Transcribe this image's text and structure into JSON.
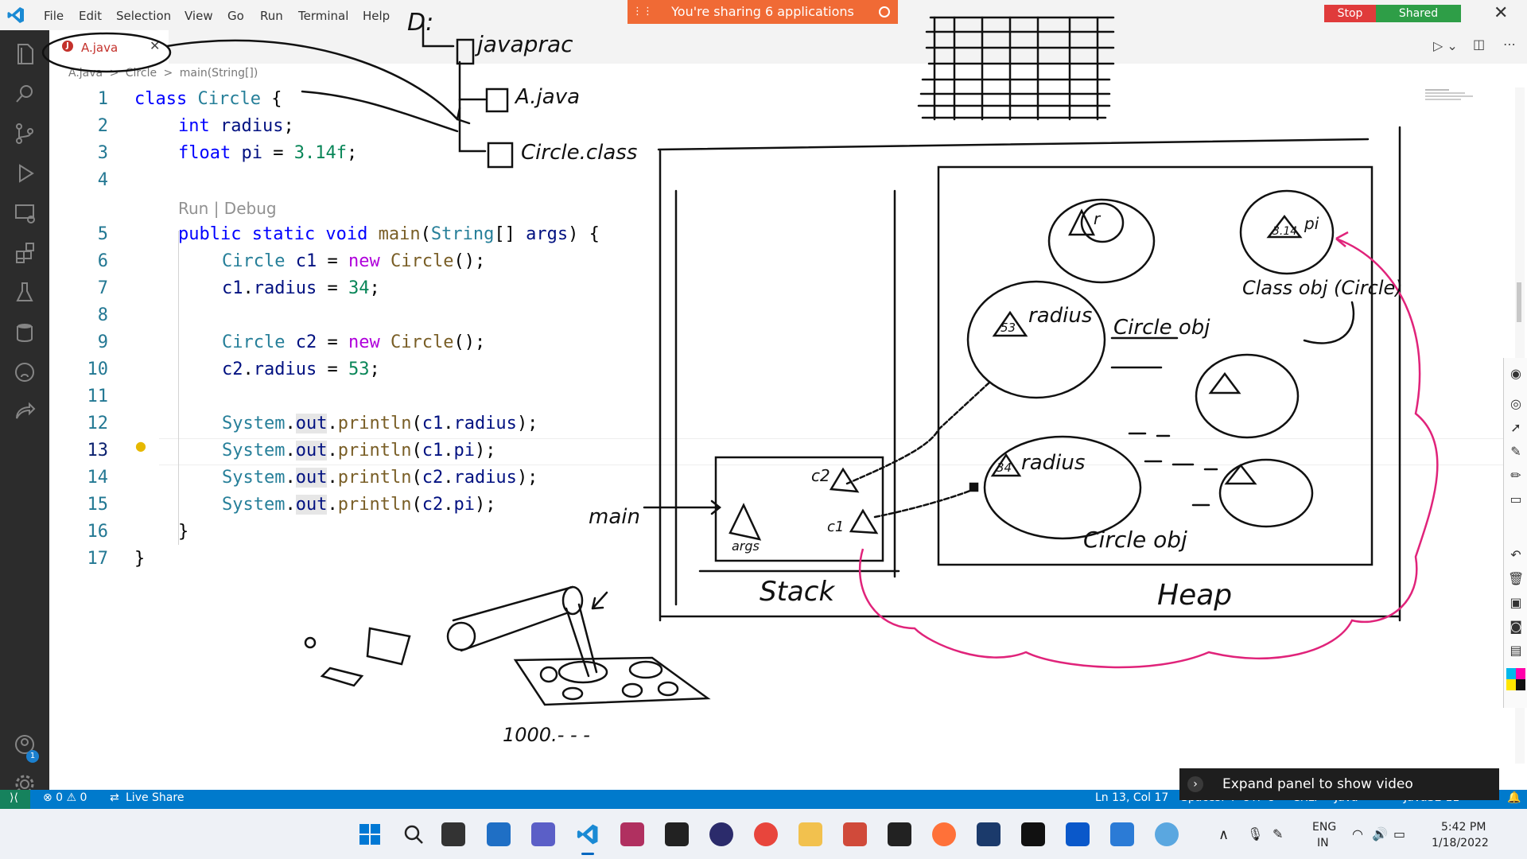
{
  "menu": [
    "File",
    "Edit",
    "Selection",
    "View",
    "Go",
    "Run",
    "Terminal",
    "Help"
  ],
  "share_banner": "You're sharing 6 applications",
  "stop_label": "Stop",
  "shared_label": "Shared",
  "tab": {
    "label": "A.java"
  },
  "breadcrumb": [
    "A.java",
    ">",
    "Circle",
    ">",
    "main(String[])"
  ],
  "codelens": "Run | Debug",
  "line_numbers": [
    "1",
    "2",
    "3",
    "4",
    "5",
    "6",
    "7",
    "8",
    "9",
    "10",
    "11",
    "12",
    "13",
    "14",
    "15",
    "16",
    "17"
  ],
  "status": {
    "problems": "⊗ 0 ⚠ 0",
    "live_share": "Live Share",
    "position": "Ln 13, Col 17",
    "spaces": "Spaces: 4",
    "encoding": "UTF-8",
    "eol": "CRLF",
    "language": "Java",
    "java": "JavaSE-11"
  },
  "video_popup": "Expand panel to show video",
  "taskbar": {
    "lang1": "ENG",
    "lang2": "IN",
    "time": "5:42 PM",
    "date": "1/18/2022"
  },
  "accounts_badge": "1",
  "sketch": {
    "drive": "D:",
    "folder": "javaprac",
    "file1": "A.java",
    "file2": "Circle.class",
    "stack": "Stack",
    "heap": "Heap",
    "main": "main",
    "args": "args",
    "c1": "c1",
    "c2": "c2",
    "radius": "radius",
    "v53": "53",
    "v34": "34",
    "v314": "3.14",
    "pi": "pi",
    "r": "r",
    "circle_obj": "Circle obj",
    "class_obj": "Class obj (Circle)",
    "circle_obj2": "Circle obj",
    "thousand": "1000.- - -"
  }
}
